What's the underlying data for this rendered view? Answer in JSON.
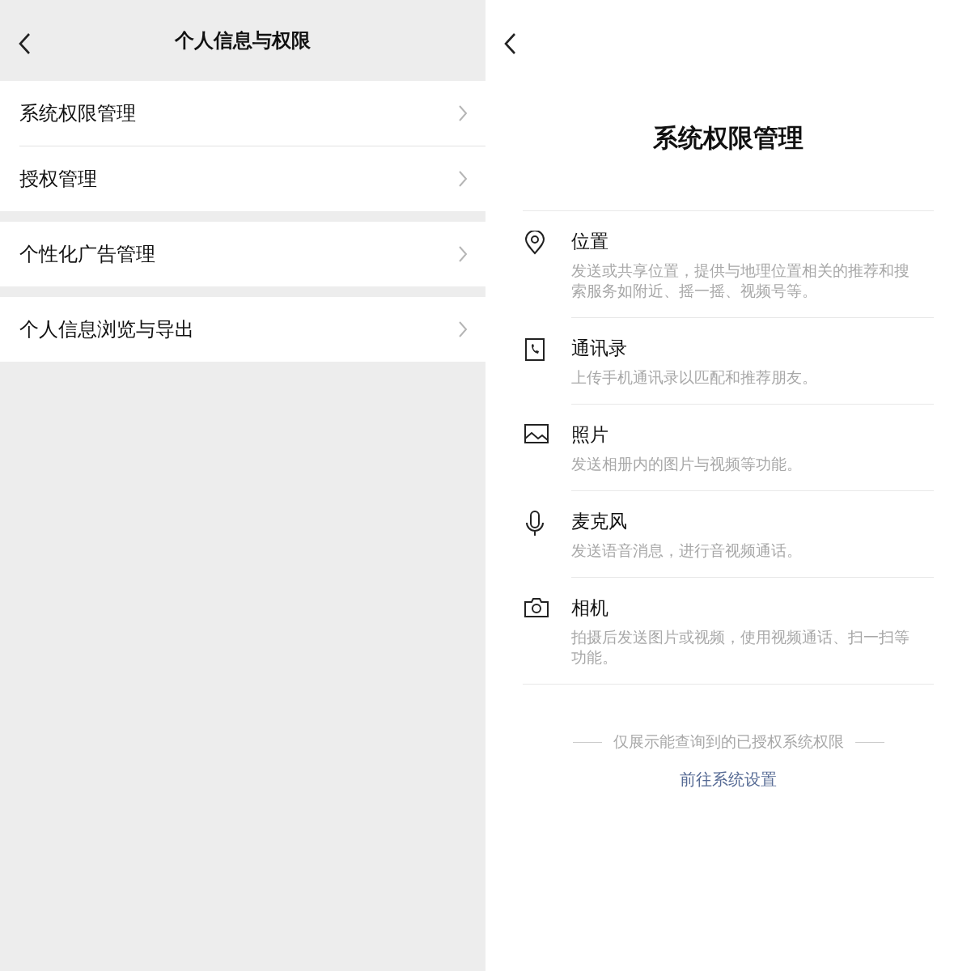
{
  "left": {
    "title": "个人信息与权限",
    "groups": [
      {
        "items": [
          "系统权限管理",
          "授权管理"
        ]
      },
      {
        "items": [
          "个性化广告管理"
        ]
      },
      {
        "items": [
          "个人信息浏览与导出"
        ]
      }
    ]
  },
  "right": {
    "title": "系统权限管理",
    "permissions": [
      {
        "kind": "location",
        "name": "位置",
        "description": "发送或共享位置，提供与地理位置相关的推荐和搜索服务如附近、摇一摇、视频号等。"
      },
      {
        "kind": "contacts",
        "name": "通讯录",
        "description": "上传手机通讯录以匹配和推荐朋友。"
      },
      {
        "kind": "photo",
        "name": "照片",
        "description": "发送相册内的图片与视频等功能。"
      },
      {
        "kind": "microphone",
        "name": "麦克风",
        "description": "发送语音消息，进行音视频通话。"
      },
      {
        "kind": "camera",
        "name": "相机",
        "description": "拍摄后发送图片或视频，使用视频通话、扫一扫等功能。"
      }
    ],
    "note": "仅展示能查询到的已授权系统权限",
    "link": "前往系统设置"
  }
}
